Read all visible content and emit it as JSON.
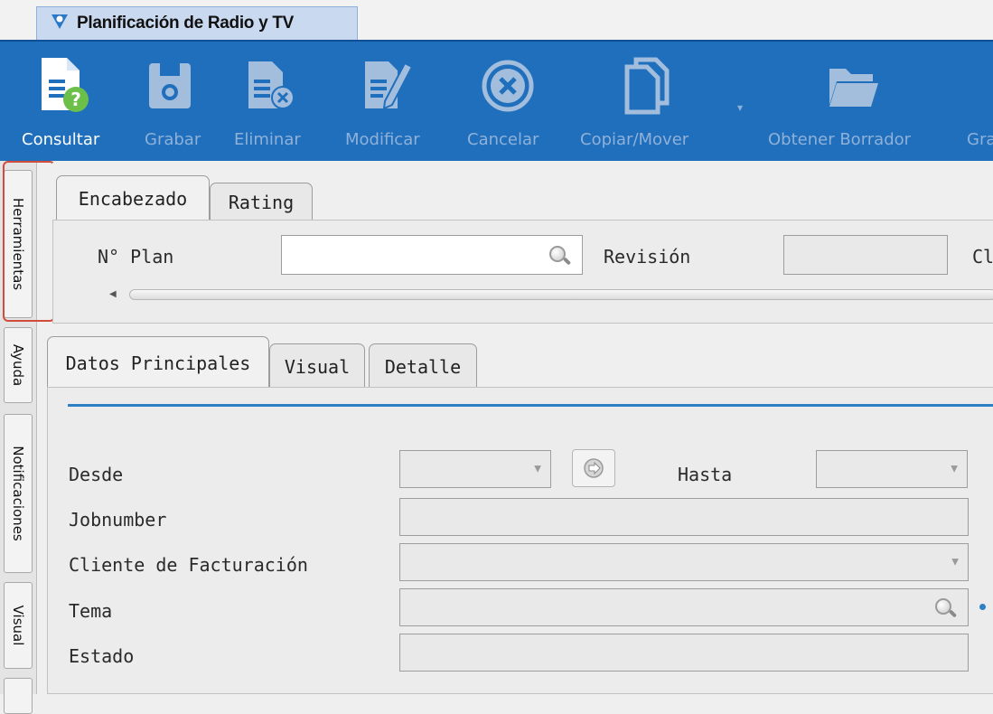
{
  "window": {
    "title": "Planificación de Radio y TV"
  },
  "toolbar": {
    "consultar": "Consultar",
    "grabar": "Grabar",
    "eliminar": "Eliminar",
    "modificar": "Modificar",
    "cancelar": "Cancelar",
    "copiar_mover": "Copiar/Mover",
    "obtener_borrador": "Obtener Borrador",
    "gra": "Gra"
  },
  "side_tabs": {
    "herramientas": "Herramientas",
    "ayuda": "Ayuda",
    "notificaciones": "Notificaciones",
    "visual": "Visual"
  },
  "header_tabs": {
    "encabezado": "Encabezado",
    "rating": "Rating"
  },
  "header_fields": {
    "nplan": "N° Plan",
    "revision": "Revisión",
    "cl": "Cl"
  },
  "detail_tabs": {
    "datos": "Datos Principales",
    "visual": "Visual",
    "detalle": "Detalle"
  },
  "form": {
    "desde": "Desde",
    "hasta": "Hasta",
    "jobnumber": "Jobnumber",
    "cliente": "Cliente de Facturación",
    "tema": "Tema",
    "estado": "Estado"
  },
  "colors": {
    "toolbar": "#1f6fbd",
    "highlight": "#d24c3b",
    "accent_line": "#2d7fc6"
  }
}
